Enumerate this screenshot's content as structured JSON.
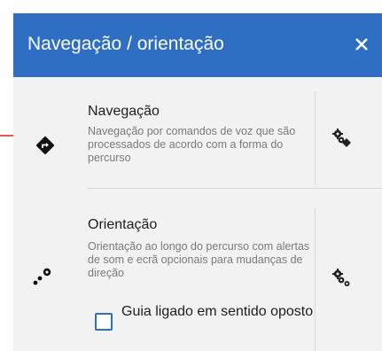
{
  "header": {
    "title": "Navegação / orientação",
    "close_icon": "close-icon"
  },
  "items": [
    {
      "title": "Navegação",
      "description": "Navegação por comandos de voz que são processados de acordo com a forma do percurso",
      "icon": "turn-right-diamond-icon",
      "settings_icon": "gears-diamond-icon"
    },
    {
      "title": "Orientação",
      "description": "Orientação ao longo do percurso com alertas de som e ecrã opcionais para mudanças de direção",
      "icon": "route-dots-icon",
      "settings_icon": "gears-dot-icon",
      "checkbox": {
        "label": "Guia ligado em sentido oposto",
        "checked": false
      }
    }
  ],
  "colors": {
    "header_bg": "#2e6fc4",
    "dialog_bg": "#f2f2f2",
    "pointer_arrow": "#e02020"
  }
}
